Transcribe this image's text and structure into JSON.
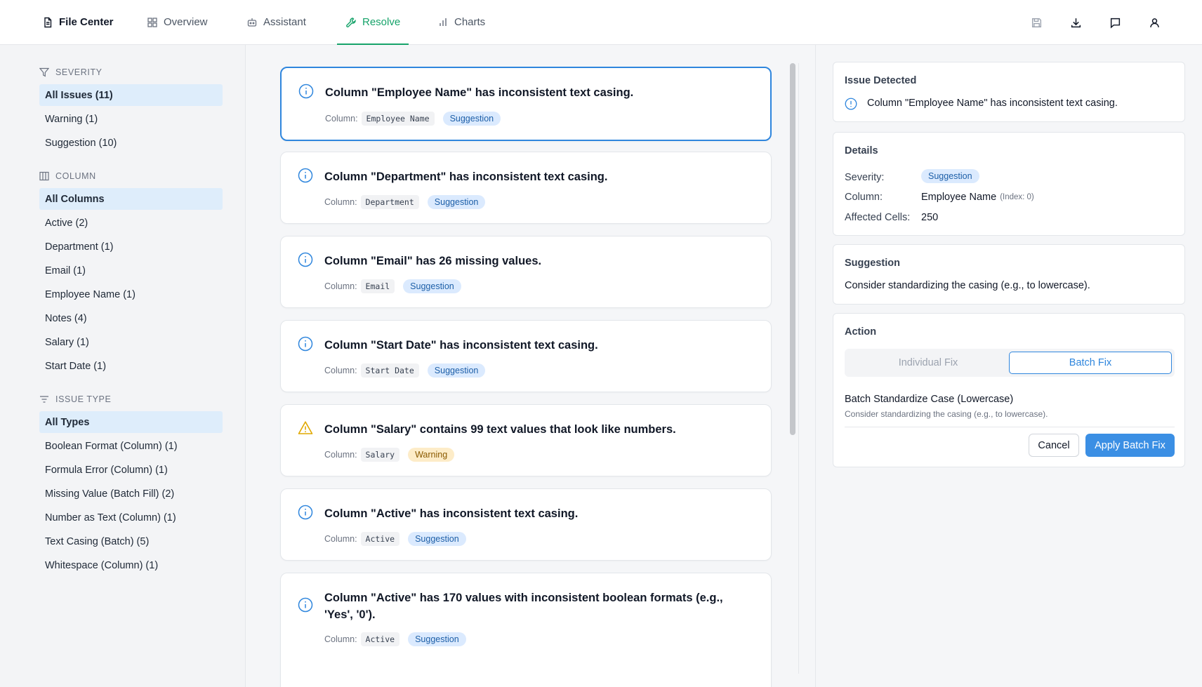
{
  "nav": {
    "brand": "File Center",
    "tabs": [
      {
        "label": "Overview",
        "icon": "grid-icon"
      },
      {
        "label": "Assistant",
        "icon": "robot-icon"
      },
      {
        "label": "Resolve",
        "icon": "wrench-icon",
        "active": true
      },
      {
        "label": "Charts",
        "icon": "bar-chart-icon"
      }
    ],
    "tools": [
      "save-icon",
      "download-icon",
      "comment-icon",
      "user-icon"
    ]
  },
  "sidebar": {
    "severity": {
      "heading": "SEVERITY",
      "items": [
        "All Issues (11)",
        "Warning (1)",
        "Suggestion (10)"
      ]
    },
    "column": {
      "heading": "COLUMN",
      "items": [
        "All Columns",
        "Active (2)",
        "Department (1)",
        "Email (1)",
        "Employee Name (1)",
        "Notes (4)",
        "Salary (1)",
        "Start Date (1)"
      ]
    },
    "issue_type": {
      "heading": "ISSUE TYPE",
      "items": [
        "All Types",
        "Boolean Format (Column) (1)",
        "Formula Error (Column) (1)",
        "Missing Value (Batch Fill) (2)",
        "Number as Text (Column) (1)",
        "Text Casing (Batch) (5)",
        "Whitespace (Column) (1)"
      ]
    }
  },
  "issues": {
    "column_label": "Column:",
    "items": [
      {
        "title": "Column \"Employee Name\" has inconsistent text casing.",
        "column": "Employee Name",
        "severity": "Suggestion",
        "kind": "info",
        "selected": true
      },
      {
        "title": "Column \"Department\" has inconsistent text casing.",
        "column": "Department",
        "severity": "Suggestion",
        "kind": "info"
      },
      {
        "title": "Column \"Email\" has 26 missing values.",
        "column": "Email",
        "severity": "Suggestion",
        "kind": "info"
      },
      {
        "title": "Column \"Start Date\" has inconsistent text casing.",
        "column": "Start Date",
        "severity": "Suggestion",
        "kind": "info"
      },
      {
        "title": "Column \"Salary\" contains 99 text values that look like numbers.",
        "column": "Salary",
        "severity": "Warning",
        "kind": "warning"
      },
      {
        "title": "Column \"Active\" has inconsistent text casing.",
        "column": "Active",
        "severity": "Suggestion",
        "kind": "info"
      },
      {
        "title": "Column \"Active\" has 170 values with inconsistent boolean formats (e.g., 'Yes', '0').",
        "column": "Active",
        "severity": "Suggestion",
        "kind": "info"
      }
    ]
  },
  "detail": {
    "issue": {
      "heading": "Issue Detected",
      "text": "Column \"Employee Name\" has inconsistent text casing."
    },
    "details": {
      "heading": "Details",
      "severity_label": "Severity:",
      "severity_value": "Suggestion",
      "column_label": "Column:",
      "column_value": "Employee Name",
      "column_index": "(Index: 0)",
      "cells_label": "Affected Cells:",
      "cells_value": "250"
    },
    "suggestion": {
      "heading": "Suggestion",
      "text": "Consider standardizing the casing (e.g., to lowercase)."
    },
    "action": {
      "heading": "Action",
      "individual": "Individual Fix",
      "batch": "Batch Fix",
      "fix_title": "Batch Standardize Case (Lowercase)",
      "fix_desc": "Consider standardizing the casing (e.g., to lowercase).",
      "cancel": "Cancel",
      "apply": "Apply Batch Fix"
    }
  },
  "colors": {
    "accent_green": "#16a36a",
    "accent_blue": "#2f86dd",
    "warning": "#e0a800"
  }
}
